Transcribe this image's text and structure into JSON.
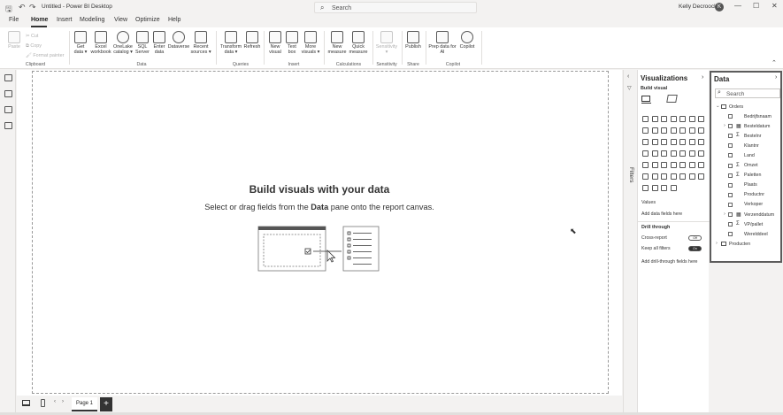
{
  "app": {
    "title": "Untitled - Power BI Desktop",
    "user": "Kelly Decroock",
    "avatar_initial": "K"
  },
  "search": {
    "placeholder": "Search"
  },
  "menu": {
    "tabs": [
      "File",
      "Home",
      "Insert",
      "Modeling",
      "View",
      "Optimize",
      "Help"
    ]
  },
  "ribbon": {
    "clipboard": {
      "paste": "Paste",
      "cut": "Cut",
      "copy": "Copy",
      "format_painter": "Format painter",
      "group": "Clipboard"
    },
    "data": {
      "get_data": "Get data",
      "excel": "Excel workbook",
      "onelake": "OneLake catalog",
      "sql": "SQL Server",
      "enter": "Enter data",
      "dataverse": "Dataverse",
      "recent": "Recent sources",
      "group": "Data"
    },
    "queries": {
      "transform": "Transform data",
      "refresh": "Refresh",
      "group": "Queries"
    },
    "insert": {
      "new_visual": "New visual",
      "text_box": "Text box",
      "more_visuals": "More visuals",
      "group": "Insert"
    },
    "calculations": {
      "new_measure": "New measure",
      "quick_measure": "Quick measure",
      "group": "Calculations"
    },
    "sensitivity": {
      "sensitivity": "Sensitivity",
      "group": "Sensitivity"
    },
    "share": {
      "publish": "Publish",
      "group": "Share"
    },
    "copilot": {
      "prep": "Prep data for AI",
      "copilot": "Copilot",
      "group": "Copilot"
    }
  },
  "canvas": {
    "empty_title": "Build visuals with your data",
    "empty_sub_1": "Select or drag fields from the ",
    "empty_sub_bold": "Data",
    "empty_sub_2": " pane onto the report canvas."
  },
  "filters": {
    "label": "Filters"
  },
  "visualizations": {
    "title": "Visualizations",
    "build": "Build visual",
    "values": "Values",
    "values_drop": "Add data fields here",
    "drill": "Drill through",
    "cross_report": "Cross-report",
    "cross_report_state": "Off",
    "keep_filters": "Keep all filters",
    "keep_filters_state": "On",
    "drill_drop": "Add drill-through fields here"
  },
  "data_pane": {
    "title": "Data",
    "search_placeholder": "Search",
    "tables": [
      {
        "name": "Orders",
        "fields": [
          {
            "name": "Bedrijfsnaam",
            "sigma": ""
          },
          {
            "name": "Besteldatum",
            "sigma": "",
            "expand": true
          },
          {
            "name": "Bestelnr",
            "sigma": "Σ"
          },
          {
            "name": "Klantnr",
            "sigma": ""
          },
          {
            "name": "Land",
            "sigma": ""
          },
          {
            "name": "Omzet",
            "sigma": "Σ"
          },
          {
            "name": "Paletten",
            "sigma": "Σ"
          },
          {
            "name": "Plaats",
            "sigma": ""
          },
          {
            "name": "Productnr",
            "sigma": ""
          },
          {
            "name": "Verkoper",
            "sigma": ""
          },
          {
            "name": "Verzenddatum",
            "sigma": "",
            "expand": true
          },
          {
            "name": "VP/pallet",
            "sigma": "Σ"
          },
          {
            "name": "Werelddeel",
            "sigma": ""
          }
        ]
      },
      {
        "name": "Producten",
        "fields": []
      }
    ]
  },
  "pages": {
    "current": "Page 1",
    "add": "+"
  }
}
